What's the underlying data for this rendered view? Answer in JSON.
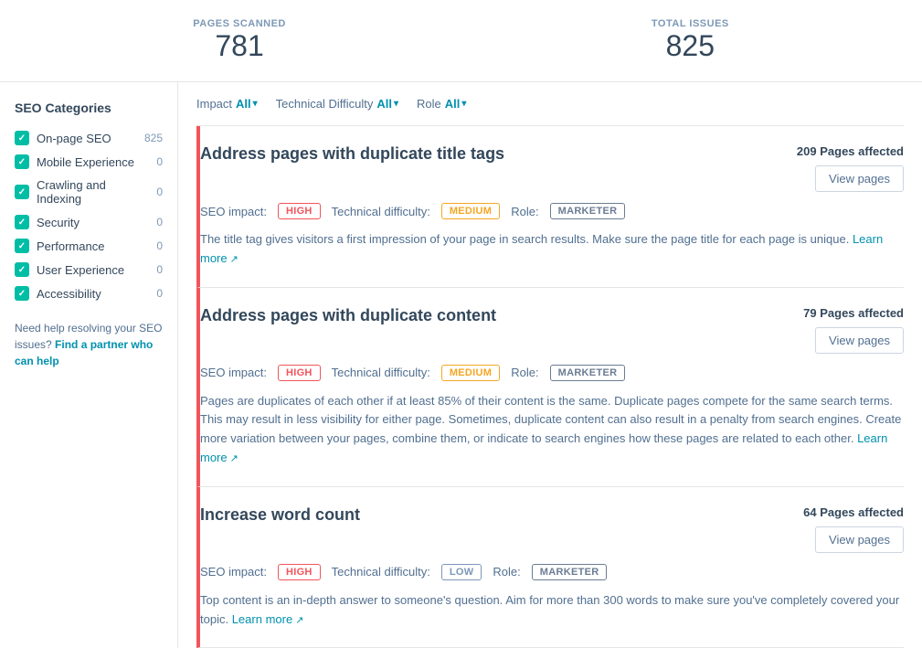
{
  "topStats": {
    "pagesScannedLabel": "PAGES SCANNED",
    "pagesScannedValue": "781",
    "totalIssuesLabel": "TOTAL ISSUES",
    "totalIssuesValue": "825"
  },
  "sidebar": {
    "title": "SEO Categories",
    "items": [
      {
        "label": "On-page SEO",
        "count": "825"
      },
      {
        "label": "Mobile Experience",
        "count": "0"
      },
      {
        "label": "Crawling and Indexing",
        "count": "0"
      },
      {
        "label": "Security",
        "count": "0"
      },
      {
        "label": "Performance",
        "count": "0"
      },
      {
        "label": "User Experience",
        "count": "0"
      },
      {
        "label": "Accessibility",
        "count": "0"
      }
    ],
    "helpText": "Need help resolving your SEO issues?",
    "helpLink": "Find a partner who can help"
  },
  "filters": {
    "impactLabel": "Impact",
    "impactValue": "All",
    "technicalDifficultyLabel": "Technical Difficulty",
    "technicalDifficultyValue": "All",
    "roleLabel": "Role",
    "roleValue": "All"
  },
  "issues": [
    {
      "title": "Address pages with duplicate title tags",
      "pagesAffectedCount": "209",
      "pagesAffectedLabel": "Pages affected",
      "viewPagesLabel": "View pages",
      "impactLabel": "SEO impact:",
      "impact": "HIGH",
      "techDiffLabel": "Technical difficulty:",
      "techDiff": "MEDIUM",
      "roleLabel": "Role:",
      "role": "MARKETER",
      "description": "The title tag gives visitors a first impression of your page in search results. Make sure the page title for each page is unique.",
      "learnMoreText": "Learn more"
    },
    {
      "title": "Address pages with duplicate content",
      "pagesAffectedCount": "79",
      "pagesAffectedLabel": "Pages affected",
      "viewPagesLabel": "View pages",
      "impactLabel": "SEO impact:",
      "impact": "HIGH",
      "techDiffLabel": "Technical difficulty:",
      "techDiff": "MEDIUM",
      "roleLabel": "Role:",
      "role": "MARKETER",
      "description": "Pages are duplicates of each other if at least 85% of their content is the same. Duplicate pages compete for the same search terms. This may result in less visibility for either page. Sometimes, duplicate content can also result in a penalty from search engines. Create more variation between your pages, combine them, or indicate to search engines how these pages are related to each other.",
      "learnMoreText": "Learn more"
    },
    {
      "title": "Increase word count",
      "pagesAffectedCount": "64",
      "pagesAffectedLabel": "Pages affected",
      "viewPagesLabel": "View pages",
      "impactLabel": "SEO impact:",
      "impact": "HIGH",
      "techDiffLabel": "Technical difficulty:",
      "techDiff": "LOW",
      "roleLabel": "Role:",
      "role": "MARKETER",
      "description": "Top content is an in-depth answer to someone's question. Aim for more than 300 words to make sure you've completely covered your topic.",
      "learnMoreText": "Learn more"
    }
  ]
}
